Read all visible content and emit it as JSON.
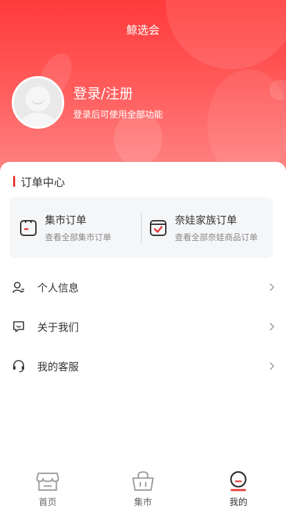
{
  "header": {
    "title": "鲸选会",
    "login_title": "登录/注册",
    "login_subtitle": "登录后可使用全部功能"
  },
  "order_center": {
    "title": "订单中心",
    "items": [
      {
        "title": "集市订单",
        "subtitle": "查看全部集市订单",
        "icon": "market-order-icon"
      },
      {
        "title": "奈娃家族订单",
        "subtitle": "查看全部奈娃商品订单",
        "icon": "family-order-icon"
      }
    ]
  },
  "menu": [
    {
      "label": "个人信息",
      "icon": "person-icon"
    },
    {
      "label": "关于我们",
      "icon": "chat-bubble-icon"
    },
    {
      "label": "我的客服",
      "icon": "headset-icon"
    }
  ],
  "tabbar": [
    {
      "label": "首页",
      "icon": "store-icon"
    },
    {
      "label": "集市",
      "icon": "basket-icon"
    },
    {
      "label": "我的",
      "icon": "profile-icon",
      "active": true
    }
  ],
  "colors": {
    "accent": "#e53935",
    "header_top": "#ff3b3b",
    "header_bottom": "#ff8a8a"
  }
}
